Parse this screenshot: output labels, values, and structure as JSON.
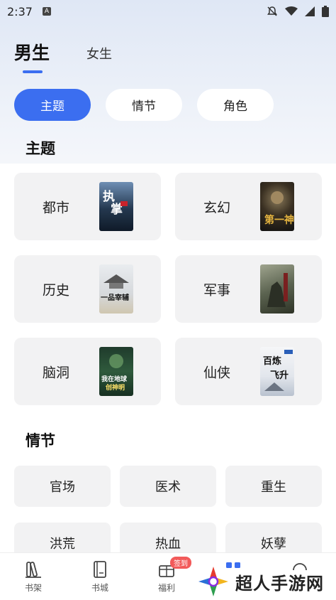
{
  "status_bar": {
    "time": "2:37",
    "notif_letter": "A"
  },
  "gender_tabs": [
    {
      "label": "男生",
      "active": true
    },
    {
      "label": "女生",
      "active": false
    }
  ],
  "filters": [
    {
      "label": "主题",
      "active": true
    },
    {
      "label": "情节",
      "active": false
    },
    {
      "label": "角色",
      "active": false
    }
  ],
  "theme_section": {
    "title": "主题",
    "cards": [
      {
        "label": "都市",
        "cover_title": "执掌"
      },
      {
        "label": "玄幻",
        "cover_title": "第一神"
      },
      {
        "label": "历史",
        "cover_title": "一品宰辅"
      },
      {
        "label": "军事",
        "cover_title": ""
      },
      {
        "label": "脑洞",
        "cover_title": "我在地球创神明"
      },
      {
        "label": "仙侠",
        "cover_title": "百炼飞升"
      }
    ]
  },
  "plot_section": {
    "title": "情节",
    "chips": [
      "官场",
      "医术",
      "重生",
      "洪荒",
      "热血",
      "妖孽"
    ]
  },
  "bottom_nav": {
    "items": [
      {
        "label": "书架",
        "icon": "bookshelf-icon"
      },
      {
        "label": "书城",
        "icon": "bookstore-icon"
      },
      {
        "label": "福利",
        "icon": "gift-icon",
        "badge": "签到"
      },
      {
        "label": "",
        "icon": "category-icon"
      },
      {
        "label": "",
        "icon": "profile-icon"
      }
    ]
  },
  "watermark": {
    "text": "超人手游网"
  },
  "colors": {
    "accent": "#3b6ef0",
    "badge": "#f25a5a",
    "card_bg": "#f2f2f3"
  }
}
